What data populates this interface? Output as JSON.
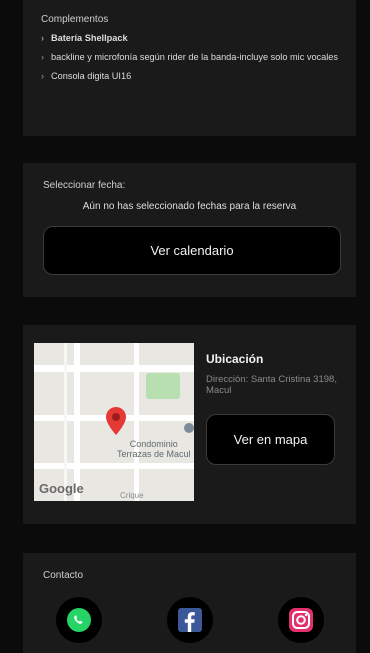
{
  "complementos": {
    "title": "Complementos",
    "items": [
      {
        "text": "Batería Shellpack"
      },
      {
        "text": "backline y  microfonía según rider de la banda-incluye solo mic vocales"
      },
      {
        "text": "Consola digita UI16"
      }
    ]
  },
  "fecha": {
    "title": "Seleccionar fecha:",
    "empty_message": "Aún no has seleccionado fechas para la reserva",
    "calendar_button": "Ver calendario"
  },
  "ubicacion": {
    "title": "Ubicación",
    "address": "Dirección: Santa Cristina 3198, Macul",
    "map_button": "Ver en mapa",
    "map": {
      "place_label_line1": "Condominio",
      "place_label_line2": "Terrazas de Macul",
      "street_label": "Crique",
      "logo": "Google"
    }
  },
  "contacto": {
    "title": "Contacto",
    "icons": [
      "whatsapp-icon",
      "facebook-icon",
      "instagram-icon"
    ]
  },
  "colors": {
    "background": "#0b0b0b",
    "card": "#1a1a1a",
    "whatsapp": "#25d366",
    "facebook": "#3b5998",
    "instagram": "#e1306c",
    "map_pin": "#e53935"
  }
}
